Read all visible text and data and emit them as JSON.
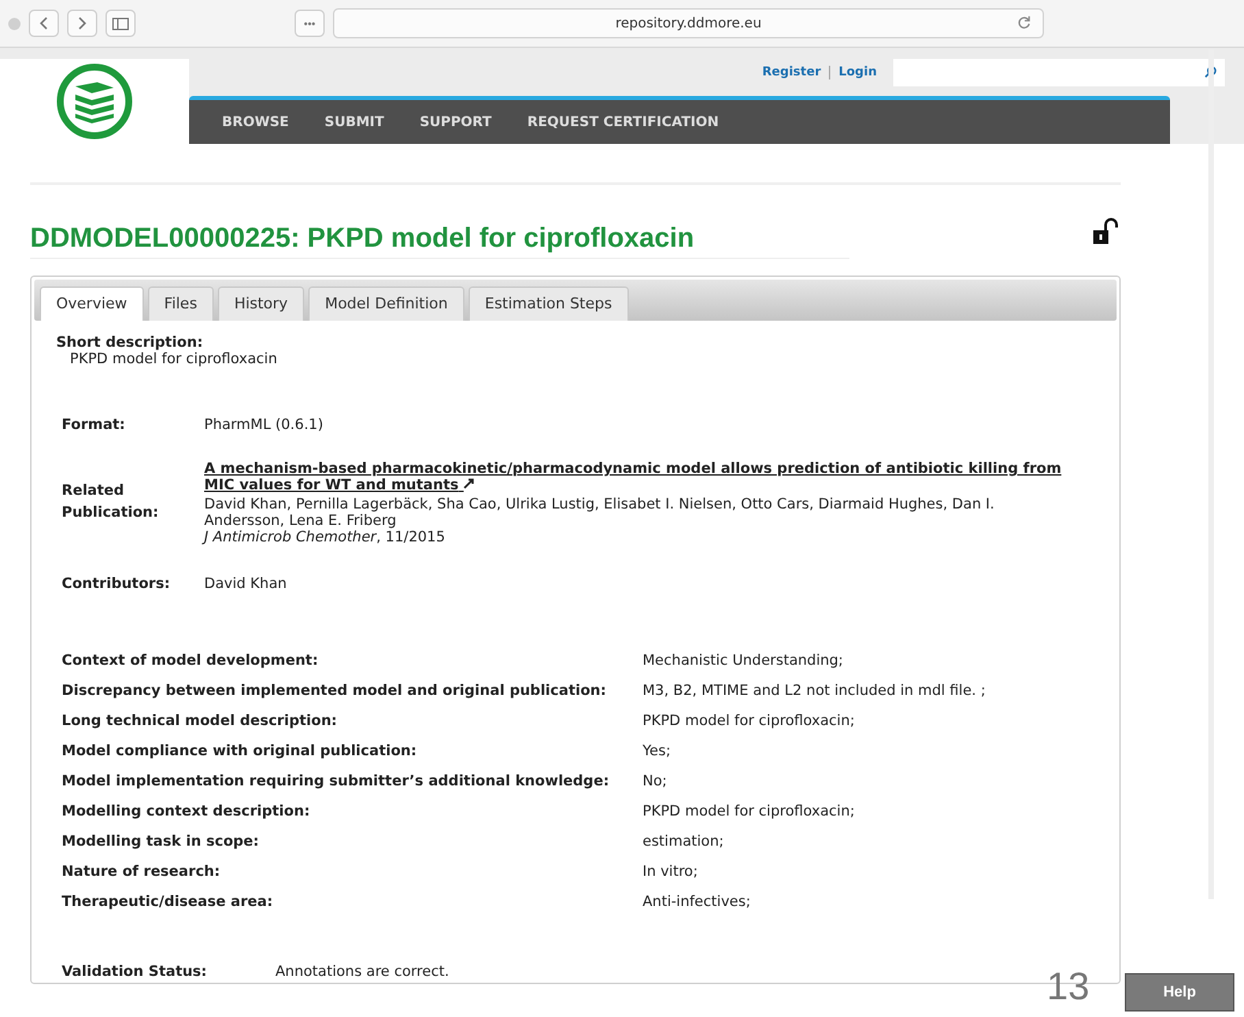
{
  "browser": {
    "url": "repository.ddmore.eu",
    "tab_button": "•••"
  },
  "header": {
    "links": [
      {
        "label": "Register"
      },
      {
        "label": "Login"
      }
    ],
    "nav": [
      {
        "label": "BROWSE"
      },
      {
        "label": "SUBMIT"
      },
      {
        "label": "SUPPORT"
      },
      {
        "label": "REQUEST CERTIFICATION"
      }
    ]
  },
  "title": "DDMODEL00000225: PKPD model for ciprofloxacin",
  "locked": false,
  "tabs": [
    {
      "label": "Overview",
      "selected": true
    },
    {
      "label": "Files",
      "selected": false
    },
    {
      "label": "History",
      "selected": false
    },
    {
      "label": "Model Definition",
      "selected": false
    },
    {
      "label": "Estimation Steps",
      "selected": false
    }
  ],
  "short_description": {
    "label": "Short description:",
    "value": "PKPD model for ciprofloxacin"
  },
  "format": {
    "label": "Format:",
    "value": "PharmML (0.6.1)"
  },
  "publication": {
    "label": "Related Publication:",
    "title": "A mechanism-based pharmacokinetic/pharmacodynamic model allows prediction of antibiotic killing from MIC values for WT and mutants",
    "authors": "David Khan, Pernilla Lagerbäck, Sha Cao, Ulrika Lustig, Elisabet I. Nielsen, Otto Cars, Diarmaid Hughes, Dan I. Andersson, Lena E. Friberg",
    "journal": "*J Antimicrob Chemother*, 11/2015"
  },
  "contributors": {
    "label": "Contributors:",
    "value": "David Khan"
  },
  "annotations": [
    {
      "label": "Context of model development:",
      "value": "Mechanistic Understanding;"
    },
    {
      "label": "Discrepancy between implemented model and original publication:",
      "value": "M3, B2, MTIME and L2 not included in mdl file. ;"
    },
    {
      "label": "Long technical model description:",
      "value": "PKPD model for ciprofloxacin;"
    },
    {
      "label": "Model compliance with original publication:",
      "value": "Yes;"
    },
    {
      "label": "Model implementation requiring submitter’s additional knowledge:",
      "value": "No;"
    },
    {
      "label": "Modelling context description:",
      "value": "PKPD model for ciprofloxacin;"
    },
    {
      "label": "Modelling task in scope:",
      "value": "estimation;"
    },
    {
      "label": "Nature of research:",
      "value": "In vitro;"
    },
    {
      "label": "Therapeutic/disease area:",
      "value": "Anti-infectives;"
    }
  ],
  "validation": {
    "label": "Validation Status:",
    "value": "Annotations are correct."
  },
  "slide_number": "13",
  "help_button": "Help"
}
